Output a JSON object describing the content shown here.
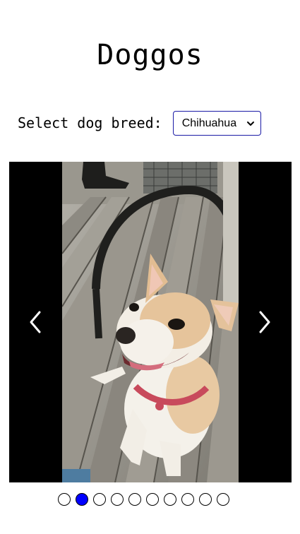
{
  "page": {
    "title": "Doggos"
  },
  "breed_selector": {
    "label": "Select dog breed:",
    "selected": "Chihuahua"
  },
  "carousel": {
    "image_alt": "Chihuahua",
    "prev_icon": "chevron-left-icon",
    "next_icon": "chevron-right-icon",
    "total_slides": 10,
    "active_index": 1
  },
  "colors": {
    "accent": "#0000ff",
    "select_border": "#1a1aa6",
    "carousel_bg": "#000000"
  }
}
